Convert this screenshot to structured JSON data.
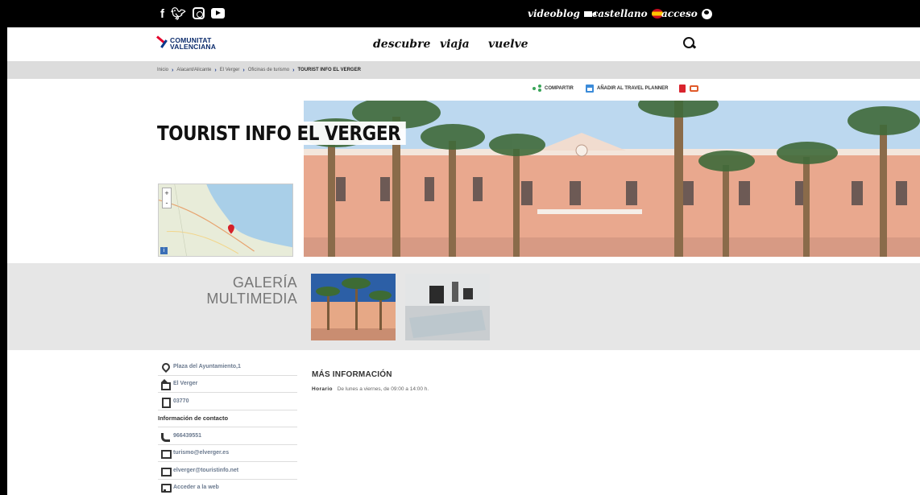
{
  "topbar": {
    "social": [
      "facebook-icon",
      "twitter-icon",
      "instagram-icon",
      "youtube-icon"
    ],
    "videoblog": "videoblog",
    "language": "castellano",
    "access": "acceso"
  },
  "header": {
    "logo_line1": "COMUNITAT",
    "logo_line2": "VALENCIANA",
    "nav": [
      "descubre",
      "viaja",
      "vuelve"
    ]
  },
  "breadcrumb": [
    "Inicio",
    "Alacant/Alicante",
    "El Verger",
    "Oficinas de turismo",
    "TOURIST INFO EL VERGER"
  ],
  "actions": {
    "share": "COMPARTIR",
    "planner": "AÑADIR AL TRAVEL PLANNER"
  },
  "hero": {
    "title": "TOURIST INFO EL VERGER"
  },
  "map": {
    "zoom_in": "+",
    "zoom_out": "-",
    "info": "i"
  },
  "gallery": {
    "title_line1": "GALERÍA",
    "title_line2": "MULTIMEDIA"
  },
  "info": {
    "address": "Plaza del Ayuntamiento,1",
    "town": "El Verger",
    "postal_code": "03770",
    "contact_heading": "Información de contacto",
    "phone": "966439551",
    "email1": "turismo@elverger.es",
    "email2": "elverger@touristinfo.net",
    "web": "Acceder a la web"
  },
  "more": {
    "title": "MÁS INFORMACIÓN",
    "horario_label": "Horario",
    "horario_value": "De lunes a viernes, de 09:00 a 14:00 h."
  },
  "colors": {
    "accent_blue": "#1d3d8f",
    "share_green": "#3aa55a",
    "pdf_red": "#d9232d"
  }
}
